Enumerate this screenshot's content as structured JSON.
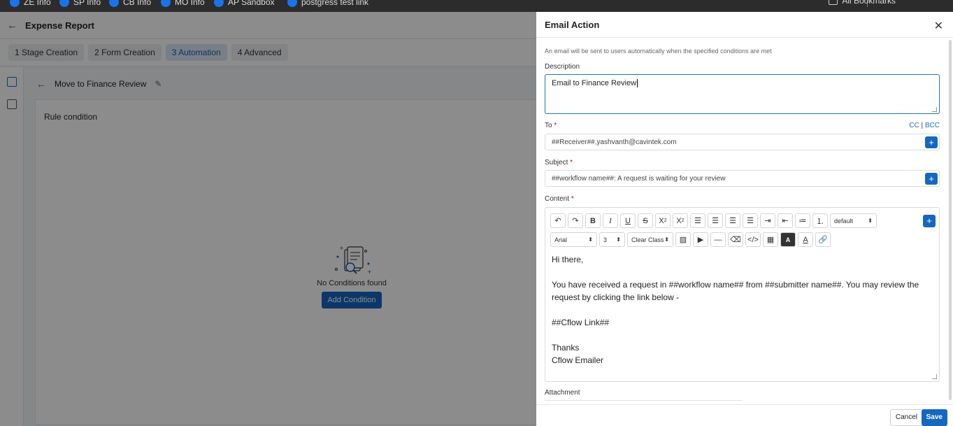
{
  "browser": {
    "bookmarks": [
      "ZE Info",
      "SP Info",
      "CB Info",
      "MO Info",
      "AP Sandbox",
      "postgress test link"
    ],
    "all_bookmarks": "All Bookmarks"
  },
  "app": {
    "title": "Expense Report",
    "tabs": [
      {
        "label": "1  Stage Creation"
      },
      {
        "label": "2  Form Creation"
      },
      {
        "label": "3  Automation"
      },
      {
        "label": "4  Advanced"
      }
    ],
    "rule_name": "Move to Finance Review",
    "card_title": "Rule condition",
    "empty_text": "No Conditions found",
    "add_condition": "Add Condition"
  },
  "drawer": {
    "title": "Email Action",
    "hint": "An email will be sent to users automatically when the specified conditions are met",
    "description_label": "Description",
    "description_value": "Email to Finance Review",
    "to_label": "To",
    "cc": "CC",
    "bcc": "BCC",
    "to_value": "##Receiver##,yashvanth@cavintek.com",
    "subject_label": "Subject",
    "subject_value": "##workflow name##: A request is waiting for your review",
    "content_label": "Content",
    "required_mark": "*",
    "toolbar": {
      "paragraph_format": "default",
      "font_family": "Arial",
      "font_size": "3",
      "class": "Clear Class"
    },
    "content_lines": [
      "Hi there,",
      "",
      "You have received a request in ##workflow name## from ##submitter name##. You may review the request by clicking the link below -",
      "",
      "##Cflow Link##",
      "",
      "Thanks",
      "Cflow Emailer"
    ],
    "attachment_label": "Attachment",
    "cancel": "Cancel",
    "save": "Save",
    "colors": {
      "primary": "#1567c0",
      "focus_border": "#1a7aa8",
      "required": "#dd0000"
    }
  }
}
